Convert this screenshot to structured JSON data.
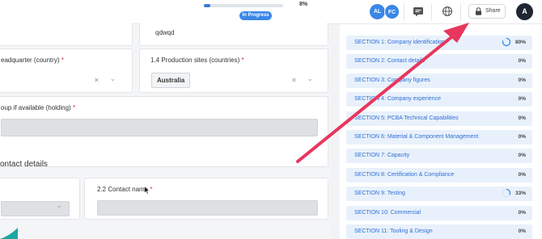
{
  "header": {
    "progress_percent": 8,
    "progress_text": "8%",
    "status": "In Progress",
    "avatars": [
      "AL",
      "FC"
    ],
    "share_label": "Share",
    "user_initial": "A"
  },
  "form": {
    "partial_value": "qdwqd",
    "hq_label": "eadquarter (country)",
    "prod_sites_label": "1.4 Production sites (countries)",
    "prod_sites_value": "Australia",
    "group_label": "oup if available (holding)",
    "section2_heading": "ontact details",
    "contact_name_label": "2.2 Contact name",
    "required_mark": "*"
  },
  "sections": [
    {
      "label": "SECTION 1: Company identification",
      "pct": "80%"
    },
    {
      "label": "SECTION 2: Contact details",
      "pct": "0%"
    },
    {
      "label": "SECTION 3: Company figures",
      "pct": "0%"
    },
    {
      "label": "SECTION 4: Company experience",
      "pct": "0%"
    },
    {
      "label": "SECTION 5: PCBA Technical Capabilities",
      "pct": "0%"
    },
    {
      "label": "SECTION 6: Material & Component Management",
      "pct": "0%"
    },
    {
      "label": "SECTION 7: Capacity",
      "pct": "0%"
    },
    {
      "label": "SECTION 8: Certification & Compliance",
      "pct": "0%"
    },
    {
      "label": "SECTION 9: Testing",
      "pct": "33%"
    },
    {
      "label": "SECTION 10: Commercial",
      "pct": "0%"
    },
    {
      "label": "SECTION 11: Tooling & Design",
      "pct": "0%"
    }
  ],
  "colors": {
    "accent": "#3a86e8",
    "section_bg": "#e8f1fb",
    "section_text": "#2f6fd6",
    "arrow": "#e8365d",
    "required": "#e02424"
  },
  "icons": {
    "chat": "chat-icon",
    "globe": "globe-icon",
    "lock": "lock-icon",
    "clear": "clear-x-icon",
    "chevron": "chevron-down-icon"
  }
}
